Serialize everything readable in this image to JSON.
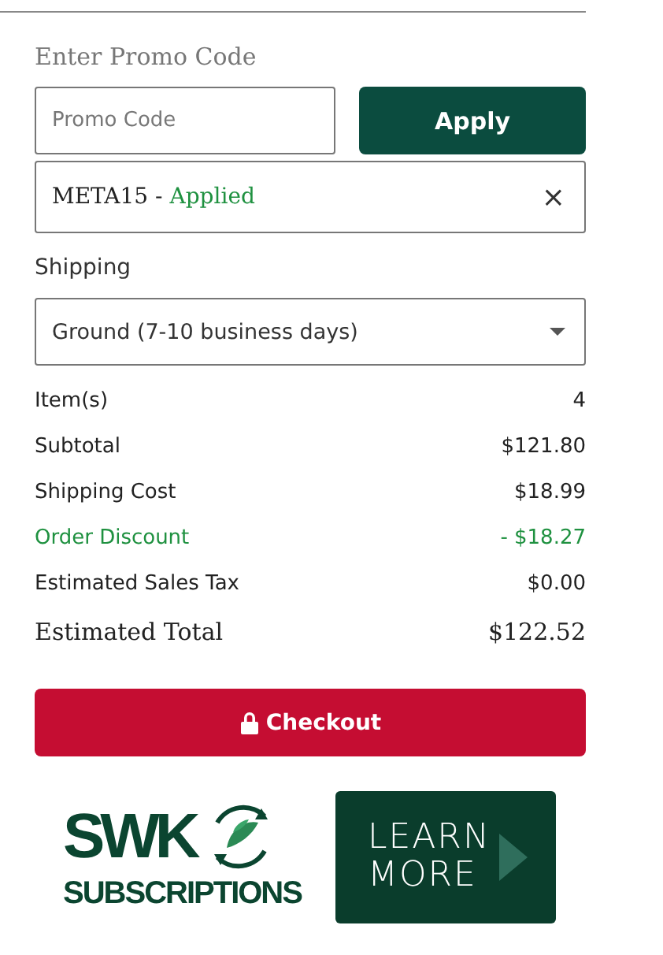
{
  "promo": {
    "heading": "Enter Promo Code",
    "placeholder": "Promo Code",
    "apply_button": "Apply",
    "applied_code": "META15",
    "applied_separator": " - ",
    "applied_status": "Applied",
    "remove_icon": "×"
  },
  "shipping": {
    "label": "Shipping",
    "selected_option": "Ground (7-10 business days)"
  },
  "summary": [
    {
      "kind": "plain",
      "label": "Item(s)",
      "value": "4"
    },
    {
      "kind": "plain",
      "label": "Subtotal",
      "value": "$121.80"
    },
    {
      "kind": "plain",
      "label": "Shipping Cost",
      "value": "$18.99"
    },
    {
      "kind": "discount",
      "label": "Order Discount",
      "value": "- $18.27"
    },
    {
      "kind": "plain",
      "label": "Estimated Sales Tax",
      "value": "$0.00"
    },
    {
      "kind": "total",
      "label": "Estimated Total",
      "value": "$122.52"
    }
  ],
  "checkout_button": "Checkout",
  "promo_banner": {
    "logo_top": "SWK",
    "logo_bottom": "SUBSCRIPTIONS",
    "cta_line_1": "LEARN",
    "cta_line_2": "MORE"
  }
}
